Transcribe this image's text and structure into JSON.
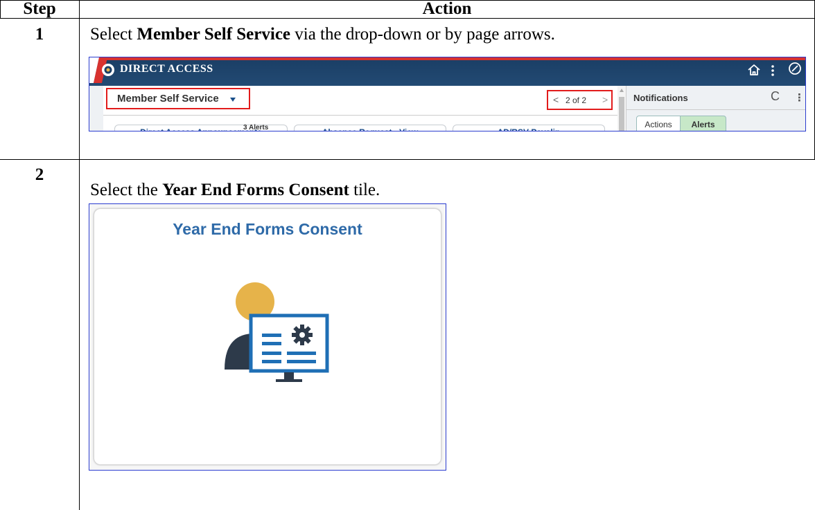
{
  "table": {
    "header": {
      "step": "Step",
      "action": "Action"
    },
    "rows": [
      {
        "step": "1",
        "instruction": {
          "pre": "Select ",
          "bold": "Member Self Service",
          "post": " via the drop-down or by page arrows."
        }
      },
      {
        "step": "2",
        "instruction": {
          "pre": "Select the ",
          "bold": "Year End Forms Consent",
          "post": " tile."
        }
      }
    ]
  },
  "screenshot1": {
    "app_title": "DIRECT ACCESS",
    "icons": [
      "coast-guard-logo-icon",
      "home-icon",
      "kebab-menu-icon",
      "compass-icon",
      "refresh-icon",
      "caret-down-icon"
    ],
    "homepage_selector": {
      "label": "Member Self Service"
    },
    "pager": {
      "prev": "<",
      "text": "2 of 2",
      "next": ">"
    },
    "tiles": [
      "Direct Access Announcements",
      "Absence Request - View",
      "AD/RSV Payslip"
    ],
    "notifications": {
      "title": "Notifications",
      "refresh": "C",
      "menu": "⋮",
      "tabs": [
        "Actions",
        "Alerts"
      ],
      "selected_tab": "Alerts",
      "count_text": "3 Alerts"
    },
    "colors": {
      "header_bg": "#1b3f66",
      "accent_red": "#e21b1b",
      "tile_text": "#1f4f8d",
      "alerts_tab": "#c7e8c8"
    }
  },
  "screenshot2": {
    "tile_title": "Year End Forms Consent",
    "icon": "person-monitor-gear-icon",
    "colors": {
      "title": "#2e6aa8",
      "person_head": "#e6b34a",
      "person_body": "#2d3a4a",
      "monitor": "#1f6fb5"
    }
  }
}
